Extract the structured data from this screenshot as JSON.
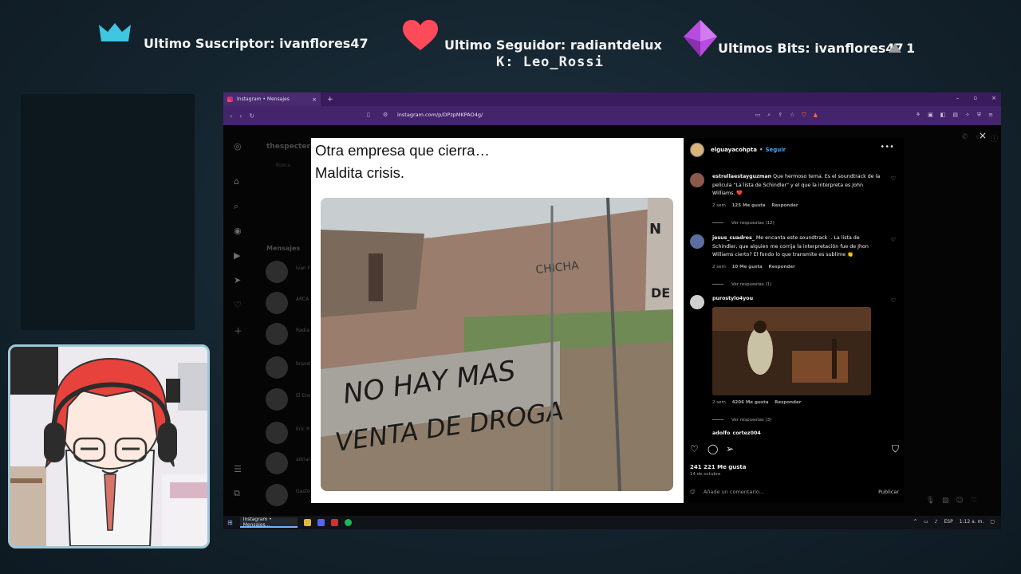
{
  "overlay": {
    "subscriber_label": "Ultimo Suscriptor: ivanflores47",
    "follower_label": "Ultimo Seguidor: radiantdelux",
    "ticker": "K: Leo_Rossi",
    "bits_label": "Ultimos Bits: ivanflores47",
    "bits_count": "1"
  },
  "browser": {
    "tab_title": "Instagram • Mensajes",
    "tab_close": "×",
    "new_tab": "+",
    "url": "instagram.com/p/DPzpMKPAO4g/",
    "window_controls": [
      "–",
      "▫",
      "×"
    ]
  },
  "instagram": {
    "account_handle": "thespecteri",
    "search_placeholder": "Busca",
    "messages_heading": "Mensajes",
    "conversations": [
      "Ivan F",
      "ARCA",
      "Radia",
      "brand",
      "El Ene",
      "Eric R",
      "adrian",
      "Gasto"
    ],
    "post": {
      "caption_line1": "Otra empresa que cierra…",
      "caption_line2": "Maldita crisis.",
      "graffiti_text": "NO HAY MAS VENTA DE DROGA"
    },
    "sidebar": {
      "author": "elguayacohpta",
      "separator": "•",
      "follow": "Seguir",
      "comments": [
        {
          "user": "estrellaestayguzman",
          "text": "Que hermoso tema. Es el soundtrack de la película \"La lista de Schindler\" y el que la interpreta es John Williams. ❤️",
          "time": "2 sem",
          "likes": "125 Me gusta",
          "reply": "Responder",
          "replies": "Ver respuestas (12)"
        },
        {
          "user": "jesus_cuadros_",
          "text": "Me encanta este soundtrack .. La lista de Schindler, que alguien me corrija la interpretación fue de Jhon Williams cierto? El fondo lo que transmite es sublime 👏",
          "time": "2 sem",
          "likes": "10 Me gusta",
          "reply": "Responder",
          "replies": "Ver respuestas (1)"
        },
        {
          "user": "purostylo4you",
          "text": "",
          "time": "2 sem",
          "likes": "4206 Me gusta",
          "reply": "Responder",
          "replies": "Ver respuestas (3)"
        }
      ],
      "next_user": "adolfo_cortez004",
      "like_count": "241 221 Me gusta",
      "date": "14 de octubre",
      "add_comment_placeholder": "Añade un comentario...",
      "publish": "Publicar"
    },
    "close": "×"
  },
  "taskbar": {
    "item_label": "Instagram • Mensajes...",
    "lang": "ESP",
    "time": "1:12 a. m."
  },
  "colors": {
    "browser_tabbar": "#3a1c5e",
    "browser_addrbar": "#44246a",
    "follow_link": "#4aa3ff",
    "heart": "#ff4a5a",
    "gem": "#b84ce0"
  }
}
